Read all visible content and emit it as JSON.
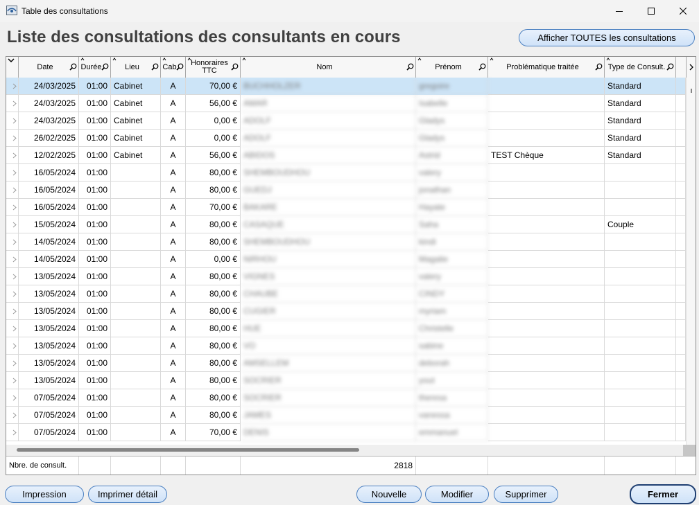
{
  "window": {
    "title": "Table des consultations"
  },
  "page": {
    "heading": "Liste des consultations des consultants en cours",
    "show_all_label": "Afficher TOUTES les consultations"
  },
  "columns": {
    "date": "Date",
    "duree": "Durée",
    "lieu": "Lieu",
    "cab": "Cab",
    "honoraires_1": "Honoraires",
    "honoraires_2": "TTC",
    "nom": "Nom",
    "prenom": "Prénom",
    "problematique": "Problématique traitée",
    "type": "Type de Consult."
  },
  "rows": [
    {
      "date": "24/03/2025",
      "duree": "01:00",
      "lieu": "Cabinet",
      "cab": "A",
      "honoraires": "70,00 €",
      "nom": "BUCHHOLZER",
      "prenom": "gregoire",
      "problematique": "",
      "type": "Standard"
    },
    {
      "date": "24/03/2025",
      "duree": "01:00",
      "lieu": "Cabinet",
      "cab": "A",
      "honoraires": "56,00 €",
      "nom": "AMAR",
      "prenom": "Isabelle",
      "problematique": "",
      "type": "Standard"
    },
    {
      "date": "24/03/2025",
      "duree": "01:00",
      "lieu": "Cabinet",
      "cab": "A",
      "honoraires": "0,00 €",
      "nom": "ADOLF",
      "prenom": "Gladys",
      "problematique": "",
      "type": "Standard"
    },
    {
      "date": "26/02/2025",
      "duree": "01:00",
      "lieu": "Cabinet",
      "cab": "A",
      "honoraires": "0,00 €",
      "nom": "ADOLF",
      "prenom": "Gladys",
      "problematique": "",
      "type": "Standard"
    },
    {
      "date": "12/02/2025",
      "duree": "01:00",
      "lieu": "Cabinet",
      "cab": "A",
      "honoraires": "56,00 €",
      "nom": "ABIDOS",
      "prenom": "Astrid",
      "problematique": "TEST Chèque",
      "type": "Standard"
    },
    {
      "date": "16/05/2024",
      "duree": "01:00",
      "lieu": "",
      "cab": "A",
      "honoraires": "80,00 €",
      "nom": "SHEMBOUDHOU",
      "prenom": "valery",
      "problematique": "",
      "type": ""
    },
    {
      "date": "16/05/2024",
      "duree": "01:00",
      "lieu": "",
      "cab": "A",
      "honoraires": "80,00 €",
      "nom": "GUEDJ",
      "prenom": "jonathan",
      "problematique": "",
      "type": ""
    },
    {
      "date": "16/05/2024",
      "duree": "01:00",
      "lieu": "",
      "cab": "A",
      "honoraires": "70,00 €",
      "nom": "BAKARE",
      "prenom": "Hayate",
      "problematique": "",
      "type": ""
    },
    {
      "date": "15/05/2024",
      "duree": "01:00",
      "lieu": "",
      "cab": "A",
      "honoraires": "80,00 €",
      "nom": "CASAQUE",
      "prenom": "Saha",
      "problematique": "",
      "type": "Couple"
    },
    {
      "date": "14/05/2024",
      "duree": "01:00",
      "lieu": "",
      "cab": "A",
      "honoraires": "80,00 €",
      "nom": "SHEMBOUDHOU",
      "prenom": "kindi",
      "problematique": "",
      "type": ""
    },
    {
      "date": "14/05/2024",
      "duree": "01:00",
      "lieu": "",
      "cab": "A",
      "honoraires": "0,00 €",
      "nom": "NIRHOU",
      "prenom": "Magalie",
      "problematique": "",
      "type": ""
    },
    {
      "date": "13/05/2024",
      "duree": "01:00",
      "lieu": "",
      "cab": "A",
      "honoraires": "80,00 €",
      "nom": "VIGNES",
      "prenom": "valery",
      "problematique": "",
      "type": ""
    },
    {
      "date": "13/05/2024",
      "duree": "01:00",
      "lieu": "",
      "cab": "A",
      "honoraires": "80,00 €",
      "nom": "CHAUBE",
      "prenom": "CINDY",
      "problematique": "",
      "type": ""
    },
    {
      "date": "13/05/2024",
      "duree": "01:00",
      "lieu": "",
      "cab": "A",
      "honoraires": "80,00 €",
      "nom": "CUGIER",
      "prenom": "myriam",
      "problematique": "",
      "type": ""
    },
    {
      "date": "13/05/2024",
      "duree": "01:00",
      "lieu": "",
      "cab": "A",
      "honoraires": "80,00 €",
      "nom": "HUE",
      "prenom": "Christelle",
      "problematique": "",
      "type": ""
    },
    {
      "date": "13/05/2024",
      "duree": "01:00",
      "lieu": "",
      "cab": "A",
      "honoraires": "80,00 €",
      "nom": "VO",
      "prenom": "sabine",
      "problematique": "",
      "type": ""
    },
    {
      "date": "13/05/2024",
      "duree": "01:00",
      "lieu": "",
      "cab": "A",
      "honoraires": "80,00 €",
      "nom": "AMSELLEM",
      "prenom": "deborah",
      "problematique": "",
      "type": ""
    },
    {
      "date": "13/05/2024",
      "duree": "01:00",
      "lieu": "",
      "cab": "A",
      "honoraires": "80,00 €",
      "nom": "SOCRIER",
      "prenom": "yout",
      "problematique": "",
      "type": ""
    },
    {
      "date": "07/05/2024",
      "duree": "01:00",
      "lieu": "",
      "cab": "A",
      "honoraires": "80,00 €",
      "nom": "SOCRIER",
      "prenom": "theresa",
      "problematique": "",
      "type": ""
    },
    {
      "date": "07/05/2024",
      "duree": "01:00",
      "lieu": "",
      "cab": "A",
      "honoraires": "80,00 €",
      "nom": "JAMES",
      "prenom": "vanessa",
      "problematique": "",
      "type": ""
    },
    {
      "date": "07/05/2024",
      "duree": "01:00",
      "lieu": "",
      "cab": "A",
      "honoraires": "70,00 €",
      "nom": "DENIS",
      "prenom": "emmanuel",
      "problematique": "",
      "type": ""
    }
  ],
  "footer": {
    "label": "Nbre. de consult.",
    "count": "2818"
  },
  "buttons": {
    "impression": "Impression",
    "imprimer_detail": "Imprimer détail",
    "nouvelle": "Nouvelle",
    "modifier": "Modifier",
    "supprimer": "Supprimer",
    "fermer": "Fermer"
  },
  "colors": {
    "selected_row": "#cce4f7",
    "button_border": "#4a7fc0",
    "heading": "#404040"
  }
}
